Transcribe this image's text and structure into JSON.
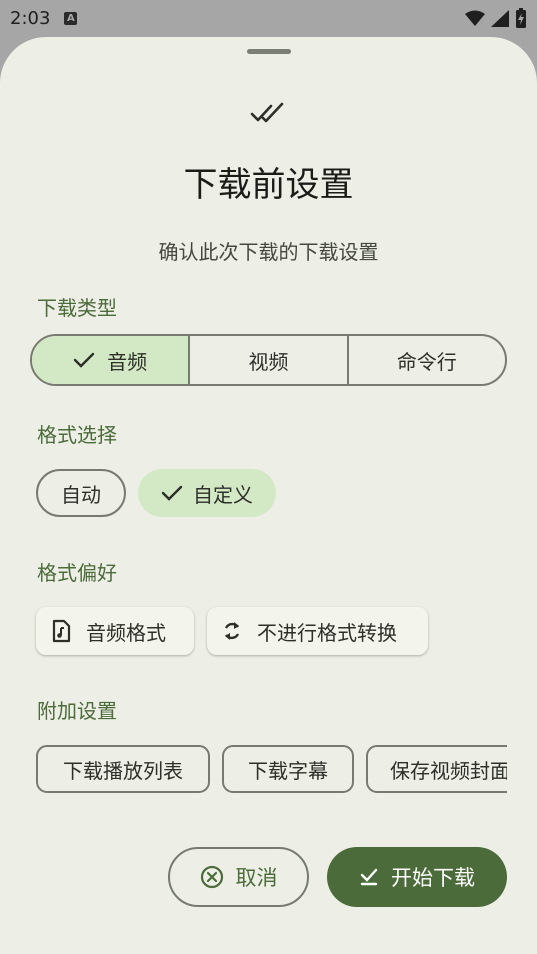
{
  "status_bar": {
    "time": "2:03",
    "notification_icon_letter": "A"
  },
  "dialog": {
    "title": "下载前设置",
    "subtitle": "确认此次下载的下载设置",
    "download_type": {
      "label": "下载类型",
      "options": [
        "音频",
        "视频",
        "命令行"
      ],
      "selected": "音频"
    },
    "format_select": {
      "label": "格式选择",
      "options": [
        "自动",
        "自定义"
      ],
      "selected": "自定义"
    },
    "format_pref": {
      "label": "格式偏好",
      "chips": [
        {
          "label": "音频格式",
          "icon": "audio-file-icon"
        },
        {
          "label": "不进行格式转换",
          "icon": "sync-icon"
        }
      ]
    },
    "extra_settings": {
      "label": "附加设置",
      "chips": [
        "下载播放列表",
        "下载字幕",
        "保存视频封面"
      ]
    },
    "buttons": {
      "cancel": "取消",
      "start": "开始下载"
    }
  },
  "colors": {
    "primary": "#4b6b3a",
    "selected_container": "#d3e8c4",
    "surface": "#edefe6"
  }
}
